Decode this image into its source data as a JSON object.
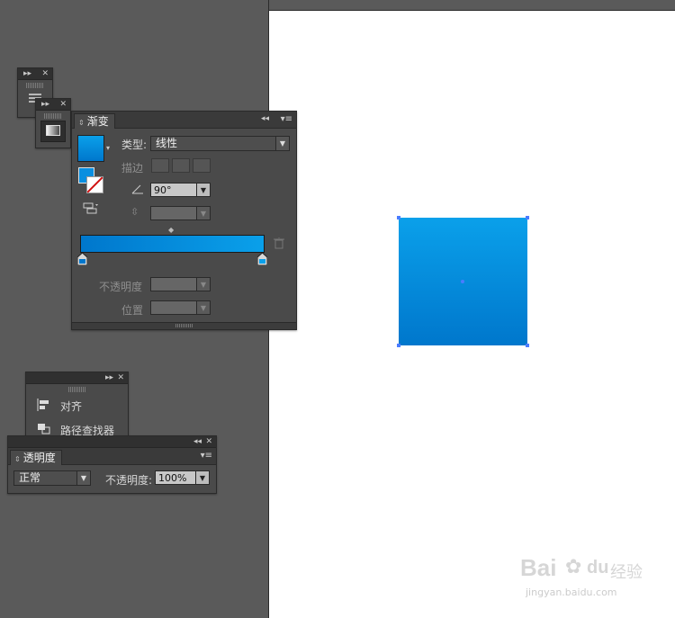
{
  "colors": {
    "workspace": "#5a5a5a",
    "canvas": "#ffffff",
    "gradient_start": "#0077cc",
    "gradient_end": "#0aa0ea",
    "selection": "#4a7cff"
  },
  "gradient_panel": {
    "tab_label": "渐变",
    "type_label": "类型:",
    "type_value": "线性",
    "stroke_label": "描边",
    "angle_value": "90°",
    "opacity_label": "不透明度",
    "position_label": "位置"
  },
  "align_panel": {
    "items": [
      {
        "label": "对齐",
        "icon": "align-icon"
      },
      {
        "label": "路径查找器",
        "icon": "pathfinder-icon"
      }
    ]
  },
  "transparency_panel": {
    "tab_label": "透明度",
    "blend_mode": "正常",
    "opacity_label": "不透明度:",
    "opacity_value": "100%"
  },
  "watermark": {
    "text_main": "Bai",
    "text_du": "du",
    "text_cn": "经验",
    "url": "jingyan.baidu.com"
  }
}
